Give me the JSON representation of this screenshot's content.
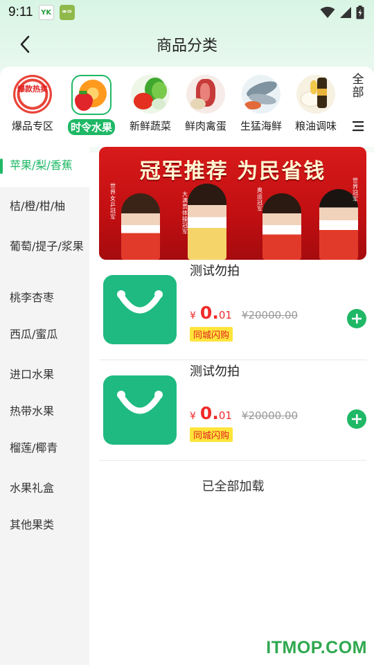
{
  "status_bar": {
    "time": "9:11",
    "app_icon_1_text": "YK",
    "app_icon_2_text": "ᄈᄆ"
  },
  "header": {
    "title": "商品分类"
  },
  "categories": [
    {
      "label": "爆品专区",
      "badge": "爆款热卖",
      "icon": "hot-sale-badge-icon"
    },
    {
      "label": "时令水果",
      "icon": "orange-strawberry-image",
      "selected": true
    },
    {
      "label": "新鲜蔬菜",
      "icon": "vegetables-image"
    },
    {
      "label": "鲜肉禽蛋",
      "icon": "meat-image"
    },
    {
      "label": "生猛海鲜",
      "icon": "seafood-image"
    },
    {
      "label": "粮油调味",
      "icon": "grain-oil-image"
    }
  ],
  "all_button": {
    "line1": "全",
    "line2": "部"
  },
  "sidebar": {
    "items": [
      {
        "label": "苹果/梨/香蕉",
        "active": true
      },
      {
        "label": "桔/橙/柑/柚"
      },
      {
        "label": "葡萄/提子/浆果"
      },
      {
        "label": "桃李杏枣"
      },
      {
        "label": "西瓜/蜜瓜"
      },
      {
        "label": "进口水果"
      },
      {
        "label": "热带水果"
      },
      {
        "label": "榴莲/椰青"
      },
      {
        "label": "水果礼盒"
      },
      {
        "label": "其他果类"
      }
    ]
  },
  "banner": {
    "title": "冠军推荐 为民省钱",
    "captions": [
      "世界女乒冠军",
      "大满贯体操冠军",
      "奥运冠军",
      "世界冠军"
    ]
  },
  "products": [
    {
      "name": "测试勿拍",
      "currency": "¥",
      "price_int": "0.",
      "price_dec": "01",
      "original_price": "¥20000.00",
      "tag": "同城闪购"
    },
    {
      "name": "测试勿拍",
      "currency": "¥",
      "price_int": "0.",
      "price_dec": "01",
      "original_price": "¥20000.00",
      "tag": "同城闪购"
    }
  ],
  "loaded_text": "已全部加载",
  "watermark": "ITMOP.COM",
  "colors": {
    "accent": "#1fb866",
    "price": "#f02b2b",
    "tag_bg": "#ffe43a",
    "banner_red": "#d81a1a"
  }
}
